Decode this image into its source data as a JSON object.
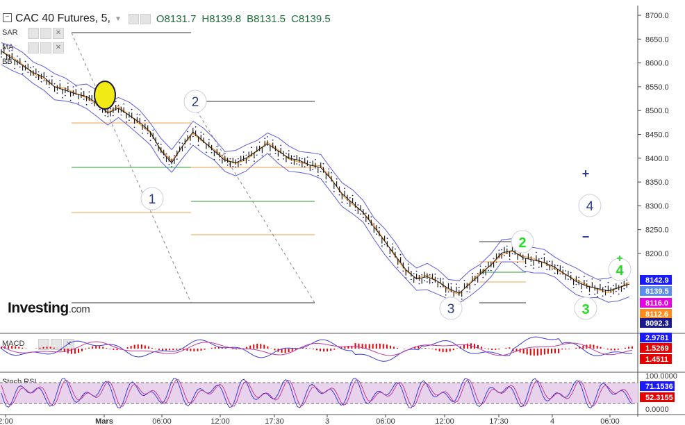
{
  "header": {
    "symbol": "CAC 40 Futures, 5,",
    "open": "O8131.7",
    "high": "H8139.8",
    "bid": "B8131.5",
    "close": "C8139.5"
  },
  "indicators": {
    "sar": "SAR",
    "ma": "MA",
    "bb": "BB",
    "macd": "MACD",
    "stochrsi": "Stoch RSI"
  },
  "logo": {
    "brand": "Investing",
    "suffix": ".com"
  },
  "price_axis": {
    "ticks": [
      "8700.0",
      "8650.0",
      "8600.0",
      "8550.0",
      "8500.0",
      "8450.0",
      "8400.0",
      "8350.0",
      "8300.0",
      "8250.0",
      "8200.0"
    ],
    "tags": [
      {
        "label": "8142.9",
        "color": "#1a1aff"
      },
      {
        "label": "8139.5",
        "color": "#5b8def"
      },
      {
        "label": "8116.0",
        "color": "#e600e6"
      },
      {
        "label": "8112.6",
        "color": "#ff8c1a"
      },
      {
        "label": "8092.3",
        "color": "#1a1a8c"
      }
    ]
  },
  "time_axis": [
    "2:00",
    "Mars",
    "06:00",
    "12:00",
    "17:30",
    "3",
    "06:00",
    "12:00",
    "17:30",
    "4",
    "06:00"
  ],
  "macd_axis": {
    "tags": [
      {
        "label": "2.9781",
        "color": "#1a1aff"
      },
      {
        "label": "1.5269",
        "color": "#e60000"
      },
      {
        "label": "1.4511",
        "color": "#e60000"
      }
    ]
  },
  "stoch_axis": {
    "top": "100.0000",
    "bottom": "0.0000",
    "tags": [
      {
        "label": "71.1536",
        "color": "#1a1aff"
      },
      {
        "label": "52.3155",
        "color": "#e60000"
      }
    ]
  },
  "wave_labels": [
    {
      "text": "1",
      "color": "#2b3a8c"
    },
    {
      "text": "2",
      "color": "#2b3a8c"
    },
    {
      "text": "3",
      "color": "#2b3a8c"
    },
    {
      "text": "4",
      "color": "#2b3a8c"
    },
    {
      "text": "2",
      "color": "#22dd22"
    },
    {
      "text": "3",
      "color": "#22dd22"
    },
    {
      "text": "4",
      "color": "#22dd22"
    }
  ],
  "markers": {
    "plus": "+",
    "minus": "−",
    "small_plus": "+"
  },
  "chart_data": {
    "type": "line",
    "series": [
      {
        "values": [
          8630,
          8615,
          8600,
          8585,
          8575,
          8555,
          8548,
          8540,
          8535,
          8520,
          8500,
          8510,
          8495,
          8480,
          8460,
          8420,
          8395,
          8430,
          8460,
          8440,
          8420,
          8400,
          8395,
          8405,
          8420,
          8435,
          8420,
          8405,
          8400,
          8390,
          8385,
          8360,
          8330,
          8310,
          8290,
          8260,
          8230,
          8200,
          8170,
          8150,
          8155,
          8145,
          8130,
          8120,
          8140,
          8160,
          8180,
          8205,
          8210,
          8195,
          8190,
          8185,
          8175,
          8160,
          8145,
          8135,
          8130,
          8125,
          8132,
          8139.5
        ]
      }
    ],
    "ylim": [
      8080,
      8720
    ],
    "colors": {
      "price": "#1a1a1a",
      "band": "#5b5bdc",
      "sar": "#1a1a8c",
      "ma": "#ff8c1a"
    }
  },
  "colors": {
    "axis": "#333333",
    "fib_green": "#2e9b2e",
    "fib_orange": "#f0a050",
    "fib_navy": "#2b3a8c",
    "stoch_fill": "#e9d3ec"
  }
}
